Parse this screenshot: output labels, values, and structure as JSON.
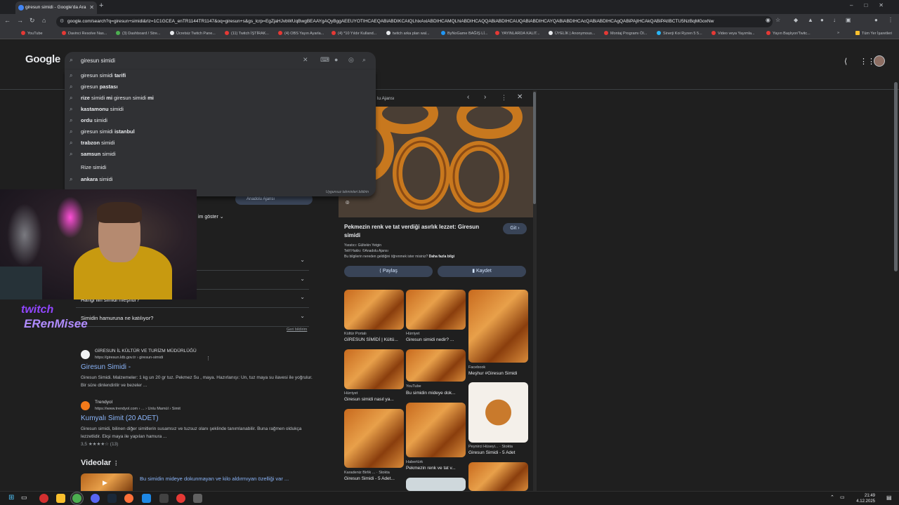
{
  "browser": {
    "tab_title": "giresun simidi - Google'da Ara",
    "url": "google.com/search?q=giresun+simidi&rlz=1C1GCEA_enTR1144TR1147&oq=giresun+s&gs_lcrp=EgZjaHJvbWUqBwgBEAAYgAQyBggAEEUYOTIHCAEQABiABDIKCAIQLhixAxiABDIHCAMQLhiABDIHCAQQABiABDIHCAUQABiABDIHCAYQABiABDIHCAcQABiABDIHCAgQABiPAjIHCAkQABiPAtIBCTU5NzBqMGoxNw",
    "bookmarks": [
      "YouTube",
      "Davinci Resolve Nas...",
      "(3) Dashboard / Stre...",
      "Ücretsiz Twitch Pane...",
      "(11) Twitch İŞTİRAK...",
      "(4) OBS Yayın Ayarla...",
      "(4) *10 Yıldır Kulland...",
      "twitch arka plan wal...",
      "ByNoGame BAĞIŞ Lİ...",
      "YAYINLARDA KALIT...",
      "ÜYELİK | Anonymous...",
      "Montaj Programı Öl...",
      "Sinerji Koi Ryzen 5 5...",
      "Video veya Yayımla...",
      "Yayın Başlıyor/Twitc..."
    ],
    "all_bookmarks": "Tüm Yer İşaretleri"
  },
  "search": {
    "logo": "Google",
    "query": "giresun simidi",
    "suggestions": [
      {
        "pre": "giresun simidi ",
        "bold": "tarifi",
        "post": ""
      },
      {
        "pre": "giresun ",
        "bold": "pastası",
        "post": ""
      },
      {
        "pre": "",
        "bold": "rize",
        "post": " simidi ",
        "bold2": "mi",
        "post2": " giresun simidi ",
        "bold3": "mi"
      },
      {
        "pre": "",
        "bold": "kastamonu",
        "post": " simidi"
      },
      {
        "pre": "",
        "bold": "ordu",
        "post": " simidi"
      },
      {
        "pre": "giresun simidi ",
        "bold": "istanbul",
        "post": ""
      },
      {
        "pre": "",
        "bold": "trabzon",
        "post": " simidi"
      },
      {
        "pre": "",
        "bold": "samsun",
        "post": " simidi"
      },
      {
        "pre": "Rize simidi",
        "bold": "",
        "post": ""
      },
      {
        "pre": "",
        "bold": "ankara",
        "post": " simidi"
      }
    ],
    "report": "Uygunsuz tahminleri bildirin"
  },
  "left": {
    "source_pill": "Anadolu Ajansı",
    "show_more": "im göster",
    "faq_partial": "Hangi ilin simidi meşhur?",
    "faq_last": "Simidin hamuruna ne katılıyor?",
    "feedback": "Geri bildirim",
    "results": [
      {
        "site": "GİRESUN İL KÜLTÜR VE TURİZM MÜDÜRLÜĞÜ",
        "url": "https://giresun.ktb.gov.tr › giresun-simidi",
        "title": "Giresun Simidi -",
        "snippet": "Giresun Simidi. Malzemeler: 1 kg un 20 gr tuz. Pekmez Su , maya. Hazırlanışı: Un, tuz maya su ilavesi ile yoğrulur. Bir süre dinlendirilir ve bezeler ..."
      },
      {
        "site": "Trendyol",
        "url": "https://www.trendyol.com › ... › Unlu Mamül › Simit",
        "title": "Kumyalı Simit (20 ADET)",
        "snippet": "Giresun simidi, bilinen diğer simitlerin susamsız ve tuzsuz olanı şeklinde tanımlanabilir. Buna rağmen oldukça lezzetlidir. Ekşi maya ile yapılan hamura ...",
        "rating": "3,5 ★★★★☆ (13)"
      }
    ],
    "videos_heading": "Videolar",
    "video_title": "Bu simidin mideye dokunmayan ve kilo aldırmıyan özelliği var ..."
  },
  "viewer": {
    "source_partial": "lu Ajansı",
    "headline": "Pekmezin renk ve tat verdiği asırlık lezzet: Giresun simidi",
    "go": "Git",
    "creator": "Yaratıcı: Gültekin Yetgin",
    "copyright": "Telif Hakkı: ©Anadolu Ajansı",
    "learn_q": "Bu bilgilerin nereden geldiğini öğrenmek ister misiniz?",
    "learn_link": "Daha fazla bilgi",
    "share": "Paylaş",
    "save": "Kaydet",
    "related": [
      {
        "src": "Kültür Portalı",
        "title": "GİRESUN SİMİDİ | Kültü..."
      },
      {
        "src": "Hürriyet",
        "title": "Giresun simidi nedir? ..."
      },
      {
        "src": "Facebook",
        "title": "Meşhur #Giresun Simidi"
      },
      {
        "src": "Hürriyet",
        "title": "Giresun simidi nasıl ya..."
      },
      {
        "src": "YouTube",
        "title": "Bu simidin mideye dok..."
      },
      {
        "src": "Peynirci Hüseyi... · Stokta",
        "title": "Giresun Simidi - 5 Adet"
      },
      {
        "src": "Karadeniz Birlik ... · Stokta",
        "title": "Giresun Simidi - 5 Adet..."
      },
      {
        "src": "Habertürk",
        "title": "Pekmezin renk ve tat v..."
      }
    ]
  },
  "stream": {
    "brand": "twitch",
    "name": "ERenMisee"
  },
  "taskbar": {
    "time": "21:49",
    "date": "4.12.2025"
  }
}
